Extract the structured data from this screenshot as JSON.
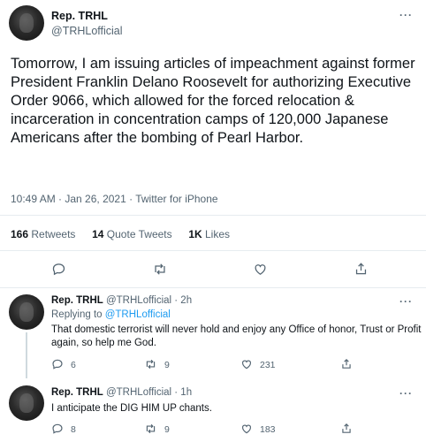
{
  "tweet": {
    "author_name": "Rep. TRHL",
    "author_handle": "@TRHLofficial",
    "text": "Tomorrow, I am issuing articles of impeachment against former President Franklin Delano Roosevelt for authorizing Executive Order 9066, which allowed for the forced relocation & incarceration in concentration camps of 120,000 Japanese Americans after the bombing of Pearl Harbor.",
    "timestamp": "10:49 AM · Jan 26, 2021 · Twitter for iPhone",
    "stats": {
      "retweets_count": "166",
      "retweets_label": "Retweets",
      "quotes_count": "14",
      "quotes_label": "Quote Tweets",
      "likes_count": "1K",
      "likes_label": "Likes"
    },
    "more_label": "···"
  },
  "replies": [
    {
      "author_name": "Rep. TRHL",
      "author_handle": "@TRHLofficial",
      "time": "· 2h",
      "replying_prefix": "Replying to ",
      "replying_to": "@TRHLofficial",
      "text": "That domestic terrorist will never hold and enjoy any Office of honor, Trust or Profit again, so help me God.",
      "replies_count": "6",
      "retweets_count": "9",
      "likes_count": "231",
      "more_label": "···"
    },
    {
      "author_name": "Rep. TRHL",
      "author_handle": "@TRHLofficial",
      "time": "· 1h",
      "text": "I anticipate the DIG HIM UP chants.",
      "replies_count": "8",
      "retweets_count": "9",
      "likes_count": "183",
      "more_label": "···"
    }
  ],
  "icons": {
    "reply": "reply-icon",
    "retweet": "retweet-icon",
    "like": "heart-icon",
    "share": "share-icon",
    "more": "more-icon"
  }
}
